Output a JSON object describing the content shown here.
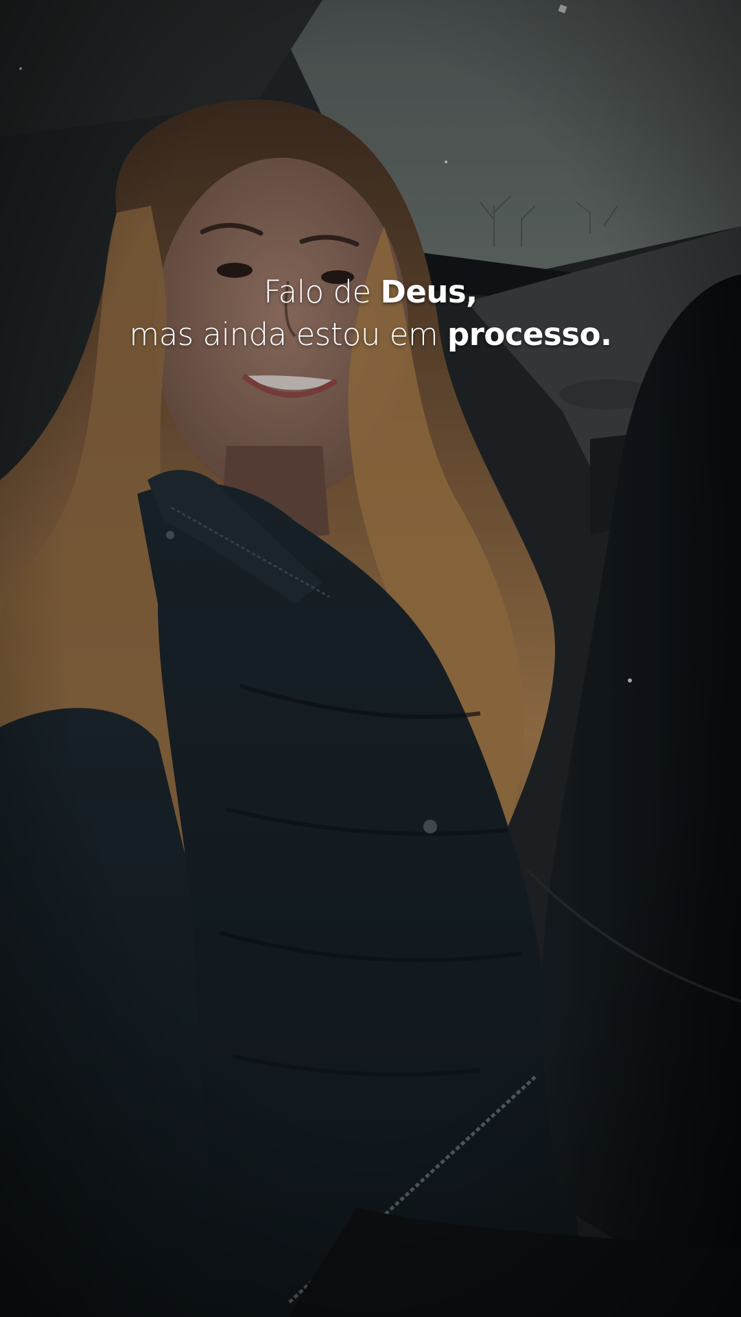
{
  "caption": {
    "line1_light": "Falo de ",
    "line1_bold": "Deus,",
    "line2_light": "mas ainda estou em ",
    "line2_bold": "processo."
  },
  "colors": {
    "text": "#ffffff",
    "jacket": "#1b2730",
    "hair": "#a77a4c",
    "sky": "#5a6668"
  }
}
